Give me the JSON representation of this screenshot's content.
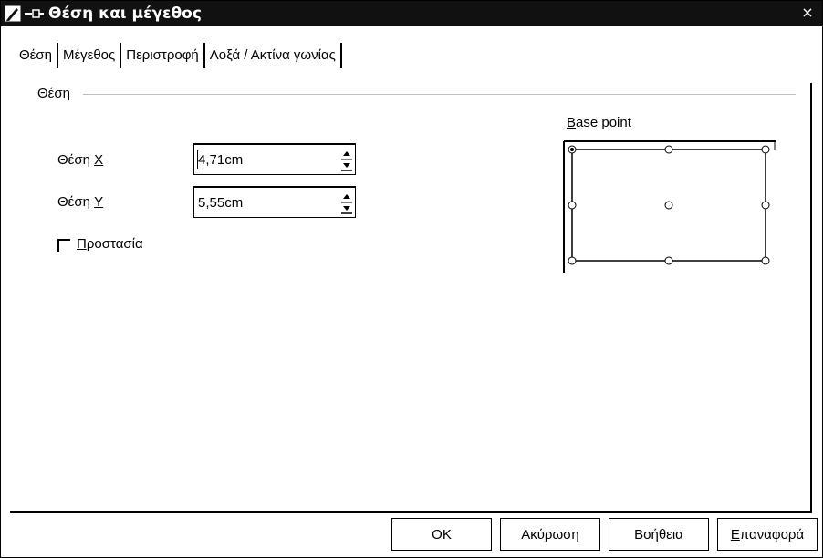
{
  "window": {
    "title": "Θέση και μέγεθος",
    "close_glyph": "×"
  },
  "tabs": [
    {
      "label": "Θέση",
      "active": true
    },
    {
      "label": "Μέγεθος",
      "active": false
    },
    {
      "label": "Περιστροφή",
      "active": false
    },
    {
      "label": "Λοξά / Ακτίνα γωνίας",
      "active": false
    }
  ],
  "position_group": {
    "label": "Θέση",
    "pos_x": {
      "label_prefix": "Θέση ",
      "label_key": "X",
      "value": "4,71cm"
    },
    "pos_y": {
      "label_prefix": "Θέση ",
      "label_key": "Y",
      "value": "5,55cm"
    },
    "protect": {
      "label_key": "Π",
      "label_rest": "ροστασία",
      "checked": false
    }
  },
  "base_point": {
    "label_key": "B",
    "label_rest": "ase point",
    "selected": "top-left"
  },
  "buttons": {
    "ok": "OK",
    "cancel": "Ακύρωση",
    "help": "Βοήθεια",
    "reset_key": "Ε",
    "reset_rest": "παναφορά"
  },
  "icons": {
    "app": "draw-app-icon",
    "pin": "pin-icon",
    "close": "close-icon",
    "spin_up": "spin-up-arrow-icon",
    "spin_down": "spin-down-arrow-icon",
    "checkbox": "checkbox-icon"
  }
}
